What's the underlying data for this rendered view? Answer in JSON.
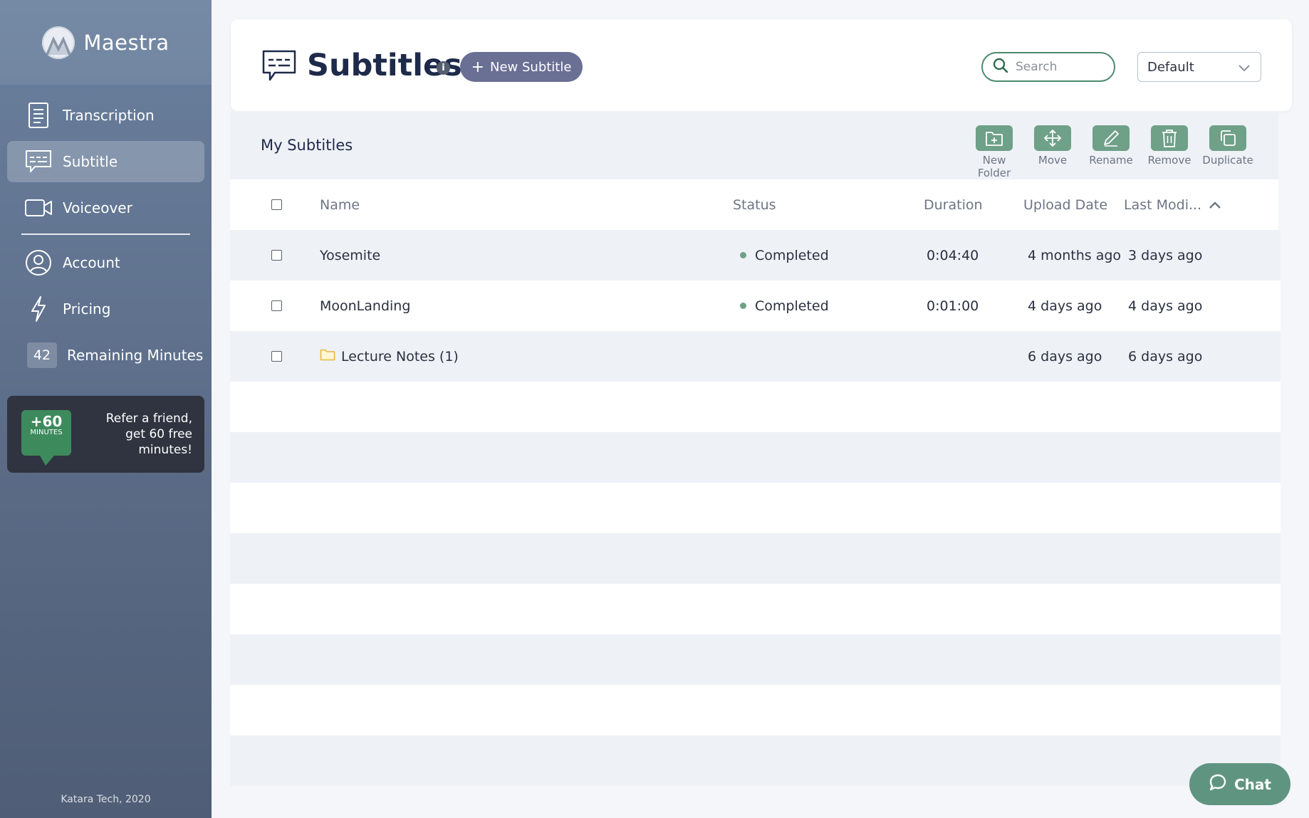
{
  "app": {
    "name": "Maestra",
    "footer": "Katara Tech, 2020"
  },
  "sidebar": {
    "items": [
      {
        "label": "Transcription",
        "icon": "document-icon"
      },
      {
        "label": "Subtitle",
        "icon": "subtitle-icon",
        "active": true
      },
      {
        "label": "Voiceover",
        "icon": "video-camera-icon"
      },
      {
        "label": "Account",
        "icon": "user-circle-icon"
      },
      {
        "label": "Pricing",
        "icon": "lightning-icon"
      }
    ],
    "remaining": {
      "count": "42",
      "label": "Remaining Minutes"
    },
    "refer": {
      "badge_plus": "+60",
      "badge_unit": "MINUTES",
      "text": "Refer a friend, get 60 free minutes!"
    }
  },
  "header": {
    "title": "Subtitles",
    "info": "i",
    "new_button": "New Subtitle",
    "search_placeholder": "Search",
    "sort_value": "Default"
  },
  "panel": {
    "title": "My Subtitles",
    "toolbar": [
      {
        "label": "New Folder",
        "icon": "new-folder-icon"
      },
      {
        "label": "Move",
        "icon": "move-icon"
      },
      {
        "label": "Rename",
        "icon": "pencil-icon"
      },
      {
        "label": "Remove",
        "icon": "trash-icon"
      },
      {
        "label": "Duplicate",
        "icon": "duplicate-icon"
      }
    ]
  },
  "table": {
    "columns": [
      "Name",
      "Status",
      "Duration",
      "Upload Date",
      "Last Modi..."
    ],
    "sort_column": "Last Modi...",
    "rows": [
      {
        "name": "Yosemite",
        "status": "Completed",
        "duration": "0:04:40",
        "upload": "4 months ago",
        "modified": "3 days ago",
        "folder": false
      },
      {
        "name": "MoonLanding",
        "status": "Completed",
        "duration": "0:01:00",
        "upload": "4 days ago",
        "modified": "4 days ago",
        "folder": false
      },
      {
        "name": "Lecture Notes (1)",
        "status": "",
        "duration": "",
        "upload": "6 days ago",
        "modified": "6 days ago",
        "folder": true
      }
    ]
  },
  "chat": {
    "label": "Chat"
  },
  "colors": {
    "accent_green": "#6fa088",
    "button_purple": "#6a6f94",
    "sidebar": "#5a6a85",
    "title_navy": "#1e2a4a"
  }
}
